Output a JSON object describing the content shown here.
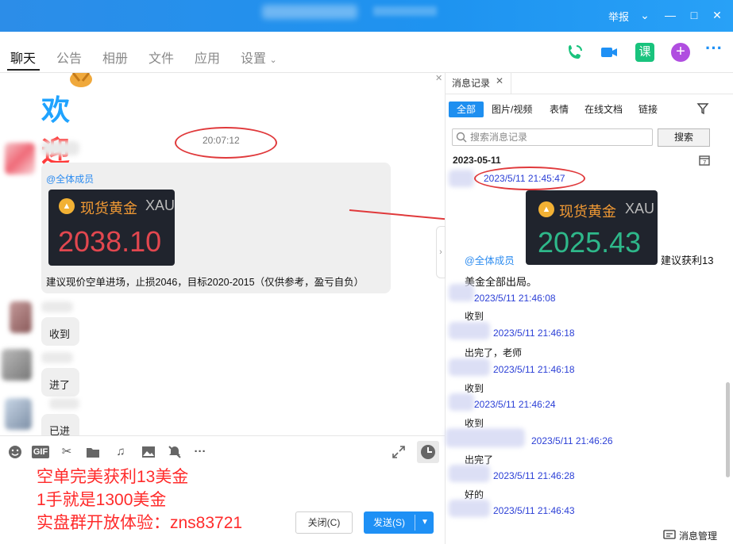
{
  "titlebar": {
    "report_label": "举报",
    "chevron_icon": "chevron-down-icon",
    "minimize_icon": "minimize-icon",
    "maximize_icon": "maximize-icon",
    "close_icon": "close-icon"
  },
  "nav": {
    "tabs": [
      "聊天",
      "公告",
      "相册",
      "文件",
      "应用",
      "设置"
    ],
    "active_tab": "聊天",
    "icons": [
      "phone-icon",
      "video-call-icon",
      "course-icon",
      "add-app-icon",
      "more-icon"
    ],
    "course_glyph": "课",
    "accent": "#1e90f5"
  },
  "chat": {
    "welcome_text": "欢迎",
    "timestamp": "20:07:12",
    "main_message": {
      "mention": "@全体成员",
      "card_title": "现货黄金",
      "card_code": "XAU",
      "card_price": "2038.10",
      "text": "建议现价空单进场，止损2046，目标2020-2015（仅供参考，盈亏自负）"
    },
    "replies": [
      "收到",
      "进了",
      "已进"
    ]
  },
  "toolbar": {
    "icons": [
      "emoji-icon",
      "gif-icon",
      "scissors-icon",
      "folder-icon",
      "music-icon",
      "image-icon",
      "mute-icon",
      "more-tools-icon"
    ],
    "gif_label": "GIF",
    "expand_icon": "expand-icon",
    "history_icon": "clock-icon"
  },
  "composer": {
    "lines": [
      "空单完美获利13美金",
      "1手就是1300美金",
      "实盘群开放体验：zns83721"
    ],
    "close_button": "关闭(C)",
    "send_button": "发送(S)"
  },
  "history_panel": {
    "tab_label": "消息记录",
    "filters": [
      "全部",
      "图片/视频",
      "表情",
      "在线文档",
      "链接"
    ],
    "active_filter": "全部",
    "search_placeholder": "搜索消息记录",
    "search_button": "搜索",
    "date_header": "2023-05-11",
    "first_time": "2023/5/11 21:45:47",
    "card_title": "现货黄金",
    "card_code": "XAU",
    "card_price": "2025.43",
    "mention": "@全体成员",
    "first_text_a": "建议获利13",
    "first_text_b": "美金全部出局。",
    "records": [
      {
        "time": "2023/5/11 21:46:08",
        "text": "收到"
      },
      {
        "time": "2023/5/11 21:46:18",
        "text": "出完了，老师"
      },
      {
        "time": "2023/5/11 21:46:18",
        "text": "收到"
      },
      {
        "time": "2023/5/11 21:46:24",
        "text": "收到"
      },
      {
        "time": "2023/5/11 21:46:26",
        "text": "出完了"
      },
      {
        "time": "2023/5/11 21:46:28",
        "text": "好的"
      },
      {
        "time": "2023/5/11 21:46:43",
        "text": ""
      }
    ],
    "footer_label": "消息管理"
  }
}
